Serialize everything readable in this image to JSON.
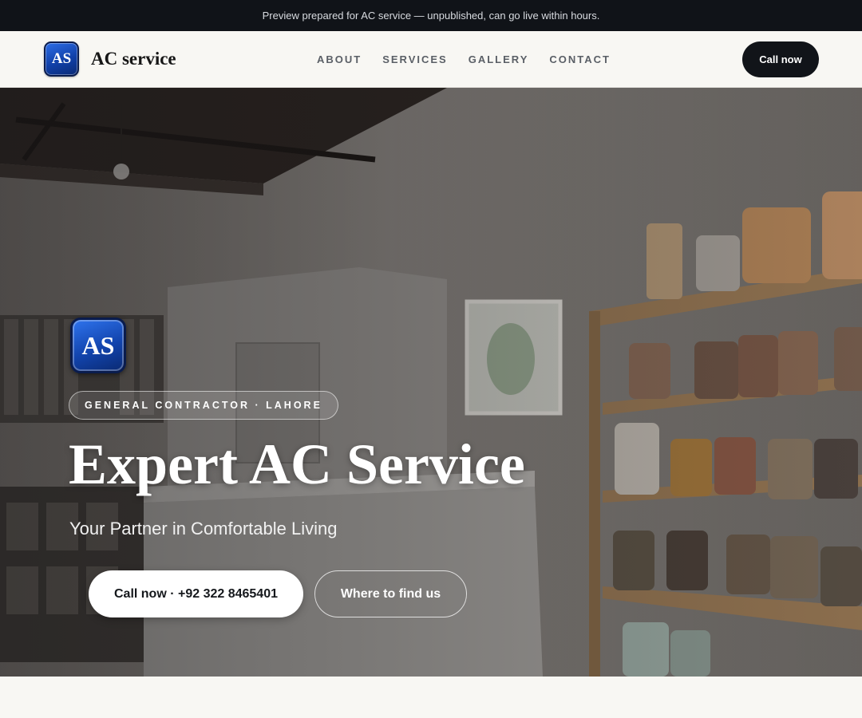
{
  "preview_bar": {
    "text": "Preview prepared for AC service — unpublished, can go live within hours."
  },
  "brand": {
    "logo_text": "AS",
    "name": "AC service"
  },
  "nav": {
    "links": [
      "ABOUT",
      "SERVICES",
      "GALLERY",
      "CONTACT"
    ],
    "cta_label": "Call now"
  },
  "hero": {
    "logo_text": "AS",
    "badge": "GENERAL CONTRACTOR · LAHORE",
    "title": "Expert AC Service",
    "subtitle": "Your Partner in Comfortable Living",
    "primary_button": "Call now · +92 322 8465401",
    "secondary_button": "Where to find us"
  },
  "colors": {
    "topbar_bg": "#101318",
    "page_bg": "#f8f7f3",
    "dark_button": "#111419",
    "logo_blue": "#1244ad"
  }
}
